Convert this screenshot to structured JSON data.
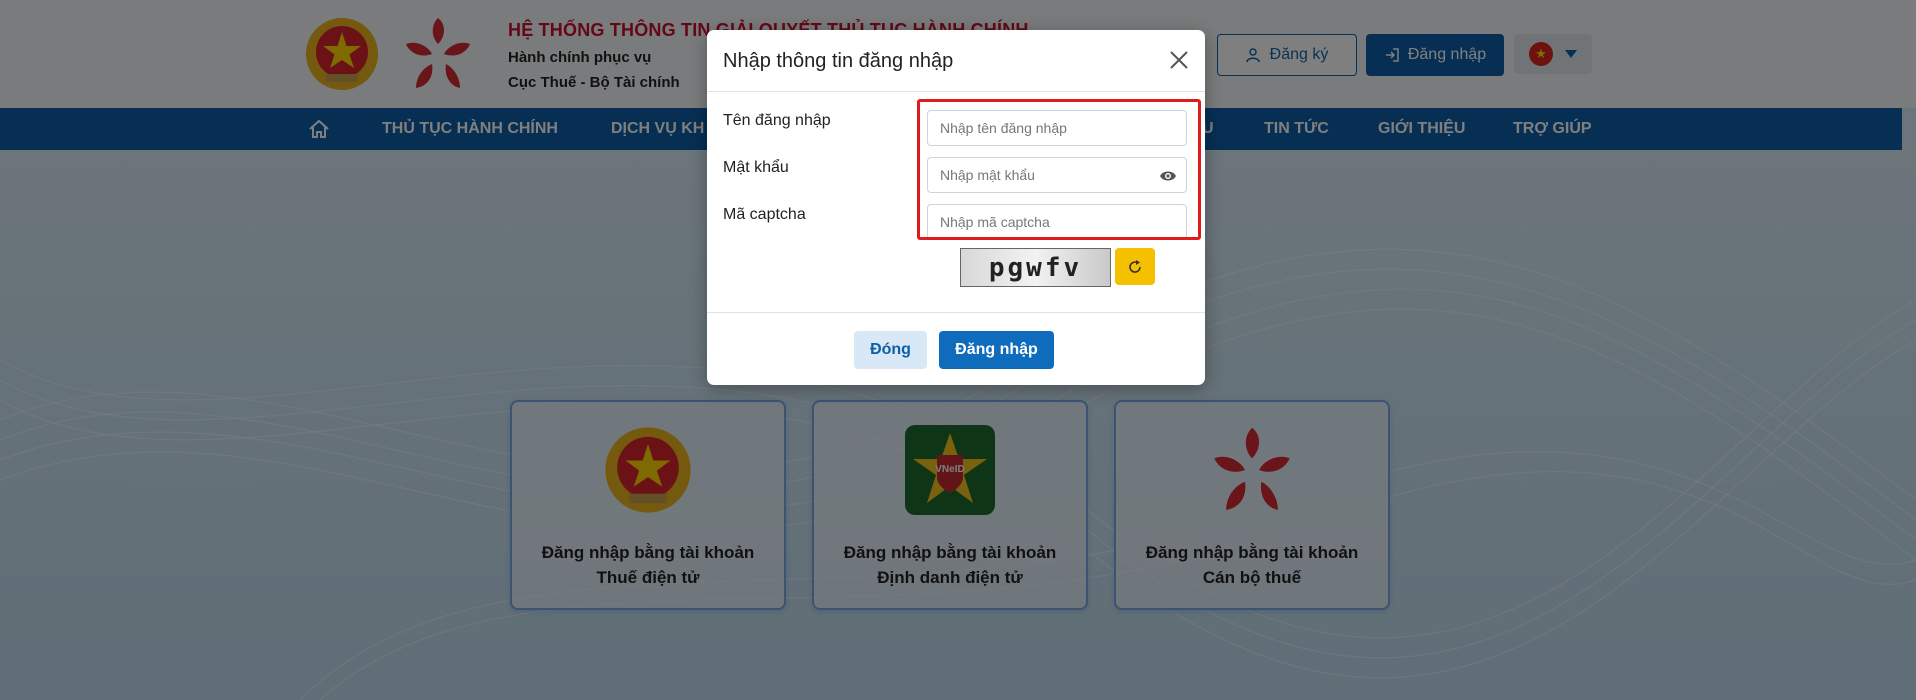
{
  "header": {
    "title": "HỆ THỐNG THÔNG TIN GIẢI QUYẾT THỦ TỤC HÀNH CHÍNH",
    "subtitle": "Hành chính phục vụ",
    "agency": "Cục Thuế - Bộ Tài chính",
    "register_label": "Đăng ký",
    "login_label": "Đăng nhập",
    "language_flag": "vietnam-flag"
  },
  "nav": {
    "items": [
      "THỦ TỤC HÀNH CHÍNH",
      "DỊCH VỤ KH",
      "U",
      "TIN TỨC",
      "GIỚI THIỆU",
      "TRỢ GIÚP"
    ]
  },
  "cards": [
    {
      "line1": "Đăng nhập bằng tài khoản",
      "line2": "Thuế điện tử",
      "icon": "national-emblem-icon"
    },
    {
      "line1": "Đăng nhập bằng tài khoản",
      "line2": "Định danh điện tử",
      "icon": "vneid-icon",
      "badge": "VNeID"
    },
    {
      "line1": "Đăng nhập bằng tài khoản",
      "line2": "Cán bộ thuế",
      "icon": "public-service-logo-icon"
    }
  ],
  "modal": {
    "title": "Nhập thông tin đăng nhập",
    "username_label": "Tên đăng nhập",
    "username_placeholder": "Nhập tên đăng nhập",
    "password_label": "Mật khẩu",
    "password_placeholder": "Nhập mật khẩu",
    "captcha_label": "Mã captcha",
    "captcha_placeholder": "Nhập mã captcha",
    "captcha_text": "pgwfv",
    "close_label": "Đóng",
    "submit_label": "Đăng nhập"
  },
  "colors": {
    "primary": "#0f5fa6",
    "brand_red": "#c8102e",
    "highlight": "#e01b1b",
    "captcha_refresh": "#f5c000"
  }
}
